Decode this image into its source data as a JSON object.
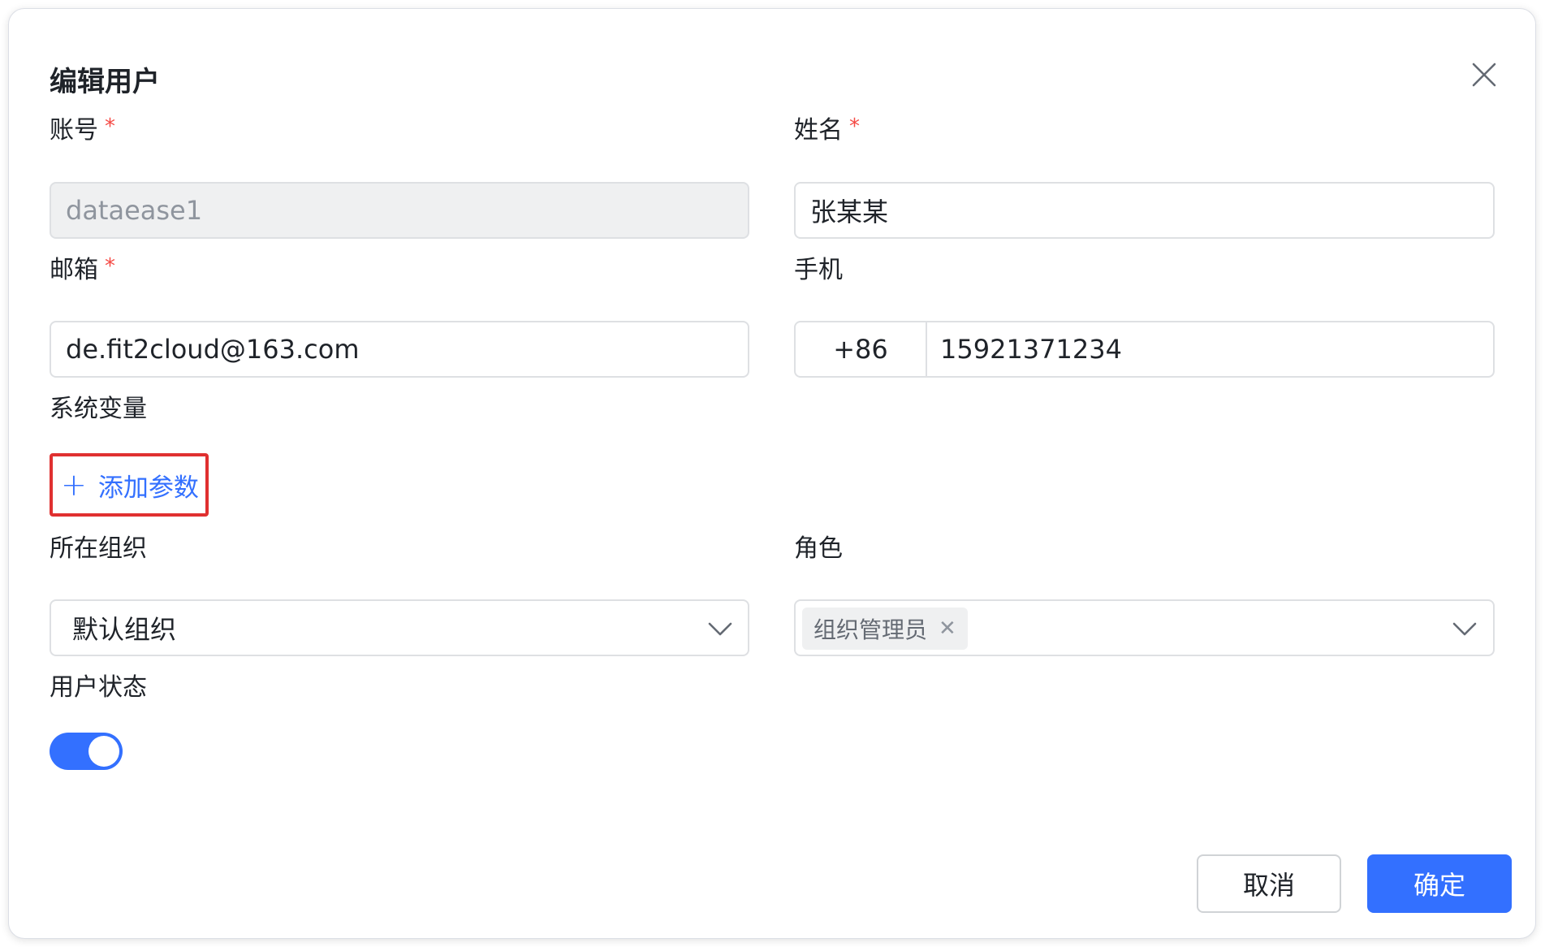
{
  "dialog": {
    "title": "编辑用户"
  },
  "form": {
    "account": {
      "label": "账号",
      "required": "*",
      "value": "dataease1"
    },
    "name": {
      "label": "姓名",
      "required": "*",
      "value": "张某某"
    },
    "email": {
      "label": "邮箱",
      "required": "*",
      "value": "de.fit2cloud@163.com"
    },
    "phone": {
      "label": "手机",
      "code": "+86",
      "value": "15921371234"
    },
    "sysvar": {
      "label": "系统变量",
      "add_label": "添加参数"
    },
    "org": {
      "label": "所在组织",
      "value": "默认组织"
    },
    "role": {
      "label": "角色",
      "tags": [
        "组织管理员"
      ]
    },
    "status": {
      "label": "用户状态",
      "enabled": true
    }
  },
  "footer": {
    "cancel_label": "取消",
    "ok_label": "确定"
  },
  "colors": {
    "primary": "#3370ff",
    "required": "#f54a45",
    "highlight_border": "#e03030"
  }
}
